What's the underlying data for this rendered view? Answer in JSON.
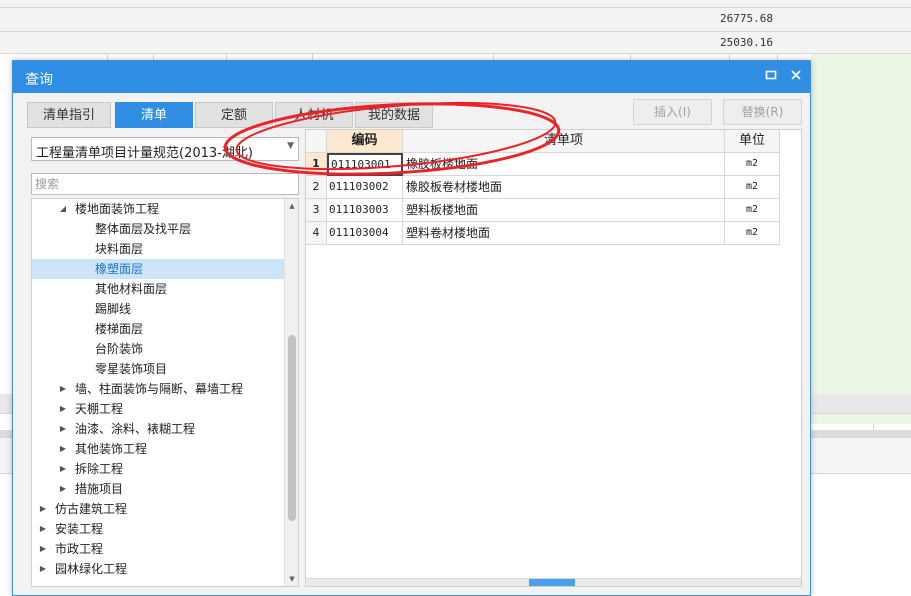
{
  "background": {
    "values": [
      "26775.68",
      "25030.16"
    ]
  },
  "dialog": {
    "title": "查询",
    "tabs": [
      {
        "label": "清单指引"
      },
      {
        "label": "清单"
      },
      {
        "label": "定额"
      },
      {
        "label": "人材机"
      },
      {
        "label": "我的数据"
      }
    ],
    "insert_label": "插入(I)",
    "replace_label": "替换(R)",
    "spec_selected": "工程量清单项目计量规范(2013-湖北)",
    "search_placeholder": "搜索",
    "tree": [
      {
        "label": "楼地面装饰工程",
        "expanded": true
      },
      {
        "label": "整体面层及找平层"
      },
      {
        "label": "块料面层"
      },
      {
        "label": "橡塑面层",
        "selected": true
      },
      {
        "label": "其他材料面层"
      },
      {
        "label": "踢脚线"
      },
      {
        "label": "楼梯面层"
      },
      {
        "label": "台阶装饰"
      },
      {
        "label": "零星装饰项目"
      },
      {
        "label": "墙、柱面装饰与隔断、幕墙工程"
      },
      {
        "label": "天棚工程"
      },
      {
        "label": "油漆、涂料、裱糊工程"
      },
      {
        "label": "其他装饰工程"
      },
      {
        "label": "拆除工程"
      },
      {
        "label": "措施项目"
      },
      {
        "label": "仿古建筑工程"
      },
      {
        "label": "安装工程"
      },
      {
        "label": "市政工程"
      },
      {
        "label": "园林绿化工程"
      }
    ],
    "grid": {
      "headers": {
        "code": "编码",
        "name": "清单项",
        "unit": "单位"
      },
      "rows": [
        {
          "num": "1",
          "code": "011103001",
          "name": "橡胶板楼地面",
          "unit": "m2"
        },
        {
          "num": "2",
          "code": "011103002",
          "name": "橡胶板卷材楼地面",
          "unit": "m2"
        },
        {
          "num": "3",
          "code": "011103003",
          "name": "塑料板楼地面",
          "unit": "m2"
        },
        {
          "num": "4",
          "code": "011103004",
          "name": "塑料卷材楼地面",
          "unit": "m2"
        }
      ]
    }
  },
  "colors": {
    "accent": "#2f8ee4",
    "annotation": "#e8232a",
    "selected_row": "#cce4f7",
    "header_highlight": "#fde9cf"
  },
  "icons": [
    "maximize-icon",
    "close-icon",
    "dropdown-arrow-icon",
    "tree-expanded-icon",
    "tree-collapsed-icon"
  ]
}
